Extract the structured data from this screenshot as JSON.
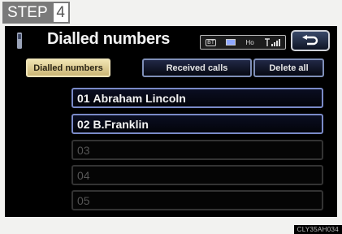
{
  "step": {
    "word": "STEP",
    "number": "4"
  },
  "header": {
    "title": "Dialled numbers",
    "back_icon": "return-arrow-icon"
  },
  "status": {
    "bt": "BT",
    "ho": "Ho",
    "signal_icon": "signal-icon"
  },
  "tabs": [
    {
      "label": "Dialled numbers",
      "active": true
    },
    {
      "label": "Received calls",
      "active": false
    },
    {
      "label": "Delete all",
      "active": false
    }
  ],
  "entries": [
    {
      "index": "01",
      "name": "Abraham Lincoln"
    },
    {
      "index": "02",
      "name": "B.Franklin"
    },
    {
      "index": "03",
      "name": ""
    },
    {
      "index": "04",
      "name": ""
    },
    {
      "index": "05",
      "name": ""
    }
  ],
  "image_code": "CLY35AH034",
  "colors": {
    "active_tab": "#d8c68c",
    "button_border": "#7a8ac8",
    "screen_bg": "#000000"
  }
}
